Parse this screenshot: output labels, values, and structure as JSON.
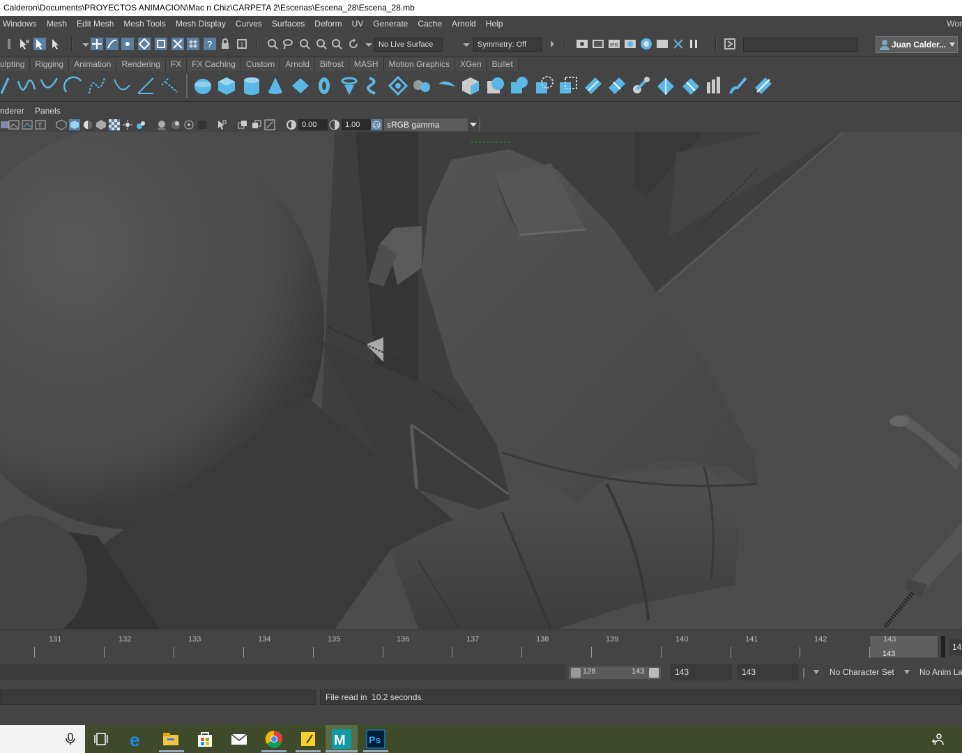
{
  "window": {
    "title": "Calderon\\Documents\\PROYECTOS ANIMACION\\Mac n Chiz\\CARPETA 2\\Escenas\\Escena_28\\Escena_28.mb"
  },
  "menubar": {
    "items": [
      "Windows",
      "Mesh",
      "Edit Mesh",
      "Mesh Tools",
      "Mesh Display",
      "Curves",
      "Surfaces",
      "Deform",
      "UV",
      "Generate",
      "Cache",
      "Arnold",
      "Help"
    ],
    "workspace_stub": "Wor"
  },
  "statusline": {
    "live_surface": "No Live Surface",
    "symmetry": "Symmetry: Off",
    "user": "Juan Calder..."
  },
  "shelf": {
    "tabs": [
      "ulpting",
      "Rigging",
      "Animation",
      "Rendering",
      "FX",
      "FX Caching",
      "Custom",
      "Arnold",
      "Bifrost",
      "MASH",
      "Motion Graphics",
      "XGen",
      "Bullet"
    ],
    "accent_color": "#5bb8e6"
  },
  "panel": {
    "menus": [
      "nderer",
      "Panels"
    ],
    "exposure": "0.00",
    "gamma": "1.00",
    "color_space": "sRGB gamma"
  },
  "timeslider": {
    "ticks": [
      "131",
      "132",
      "133",
      "134",
      "135",
      "136",
      "137",
      "138",
      "139",
      "140",
      "141",
      "142",
      "143"
    ],
    "current_frame": "143",
    "next_stub": "14"
  },
  "rangeslider": {
    "range_start": "128",
    "range_end": "143",
    "anim_end": "143",
    "playback_end": "143",
    "character_set": "No Character Set",
    "anim_layer": "No Anim Lay"
  },
  "commandline": {
    "result": "File read in  10.2 seconds."
  },
  "taskbar": {
    "apps": [
      "microphone-icon",
      "task-view-icon",
      "edge-icon",
      "file-explorer-icon",
      "store-icon",
      "mail-icon",
      "chrome-icon",
      "sticky-notes-icon",
      "maya-icon",
      "photoshop-icon"
    ]
  }
}
